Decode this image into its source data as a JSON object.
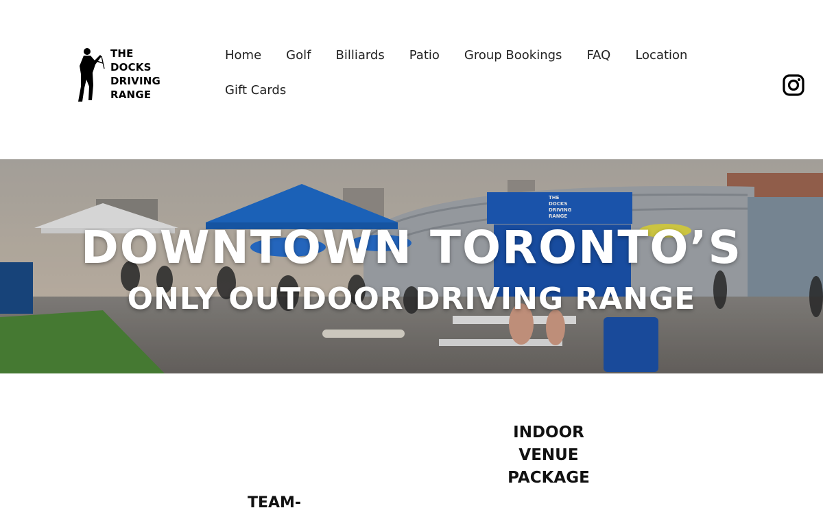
{
  "header": {
    "logo": {
      "lines": [
        "THE",
        "DOCKS",
        "DRIVING",
        "RANGE"
      ],
      "icon": "golfer-silhouette-icon"
    },
    "nav": {
      "row1": [
        "Home",
        "Golf",
        "Billiards",
        "Patio",
        "Group Bookings",
        "FAQ",
        "Location"
      ],
      "row2": [
        "Gift Cards"
      ]
    },
    "social": {
      "icon": "instagram-icon"
    }
  },
  "hero": {
    "line1": "DOWNTOWN TORONTO’S",
    "line2": "ONLY OUTDOOR DRIVING RANGE",
    "sign_text": [
      "THE",
      "DOCKS",
      "DRIVING",
      "RANGE"
    ]
  },
  "sections": {
    "indoor_package": [
      "INDOOR",
      "VENUE",
      "PACKAGE"
    ],
    "team_title": "TEAM-"
  },
  "colors": {
    "tent_blue": "#1f6fd1",
    "sky": "#c9c1b6",
    "grass": "#4f8a3a"
  }
}
